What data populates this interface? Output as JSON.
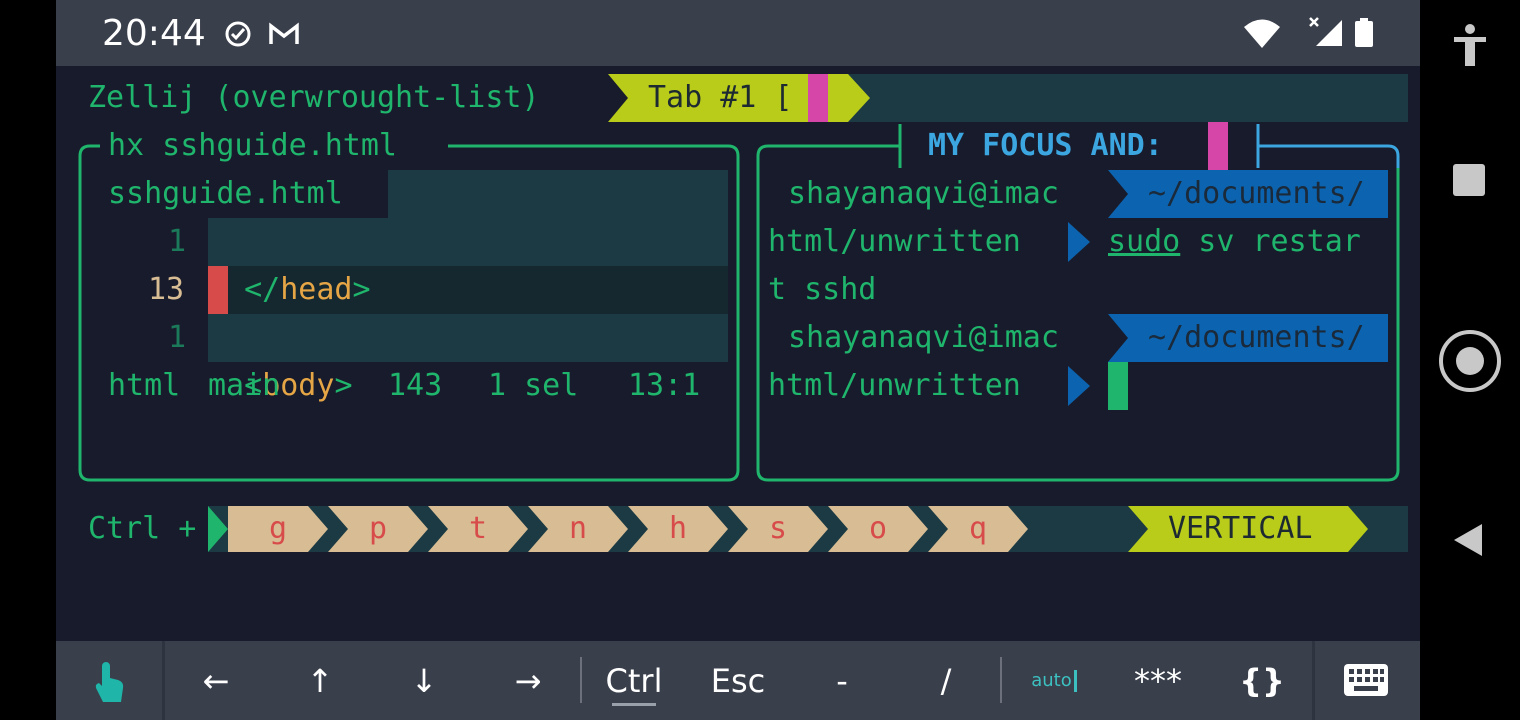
{
  "status_bar": {
    "time": "20:44",
    "icons": [
      "check-circle-icon",
      "gmail-icon",
      "wifi-icon",
      "no-signal-icon",
      "battery-icon"
    ]
  },
  "nav_bar": {
    "icons": [
      "accessibility-icon",
      "recents-icon",
      "home-icon",
      "back-icon"
    ]
  },
  "zellij": {
    "session_label": "Zellij (overwrought-list)",
    "tab_label": "Tab #1 [ ]",
    "left_pane_title": "hx sshguide.html",
    "right_pane_title": "MY FOCUS AND:",
    "editor": {
      "filename": "sshguide.html",
      "lines": [
        {
          "num": "1",
          "bracket_open": "</",
          "tag": "head",
          "bracket_close": ">"
        },
        {
          "num": "13"
        },
        {
          "num": "1",
          "bracket_open": "<",
          "tag": "body",
          "bracket_close": ">"
        }
      ],
      "status": {
        "mode": "html",
        "branch": "main",
        "col1": "143",
        "sel": "1 sel",
        "pos": "13:1"
      }
    },
    "shell": {
      "user": "shayanaqvi@imac",
      "path": "~/documents/",
      "path_cont": "html/unwritten",
      "cmd_word": "sudo",
      "cmd_rest": " sv restar",
      "cmd_wrap": "t sshd"
    },
    "keybar": {
      "prefix": "Ctrl +",
      "keys": [
        "g",
        "p",
        "t",
        "n",
        "h",
        "s",
        "o",
        "q"
      ],
      "mode": "VERTICAL"
    }
  },
  "extra_keys": {
    "keys": [
      "←",
      "↑",
      "↓",
      "→",
      "Ctrl",
      "Esc",
      "-",
      "/",
      "auto",
      "***",
      "{}"
    ],
    "icons": [
      "touch-icon",
      "keyboard-icon"
    ]
  },
  "colors": {
    "green": "#1fb56c",
    "orange": "#e6a646",
    "red": "#d84b4b",
    "lime": "#b9cc1a",
    "magenta": "#d646a8",
    "blue": "#3ca6e0",
    "pathbg": "#0c64b0",
    "tan": "#d8bd94",
    "teal": "#1b3a43"
  }
}
